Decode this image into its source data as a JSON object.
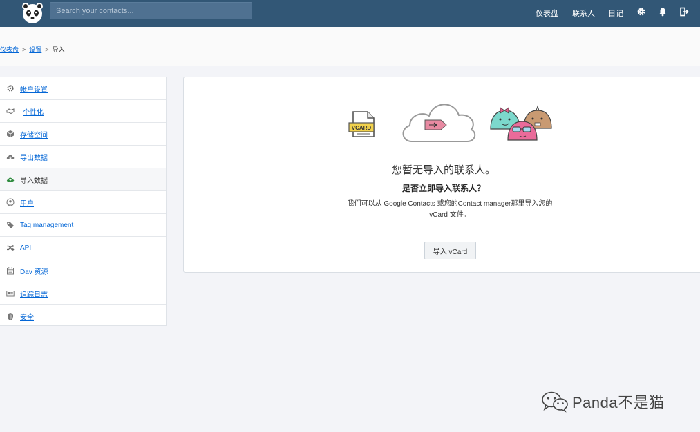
{
  "header": {
    "search_placeholder": "Search your contacts...",
    "nav": {
      "dashboard": "仪表盘",
      "contacts": "联系人",
      "journal": "日记"
    }
  },
  "breadcrumb": {
    "items": [
      "仪表盘",
      "设置",
      "导入"
    ],
    "separator": ">"
  },
  "sidebar": {
    "items": [
      {
        "label": "帐户设置",
        "icon": "gear-icon"
      },
      {
        "label": "个性化",
        "icon": "handshake-icon"
      },
      {
        "label": "存储空间",
        "icon": "cube-icon"
      },
      {
        "label": "导出数据",
        "icon": "cloud-download-icon"
      },
      {
        "label": "导入数据",
        "icon": "cloud-upload-icon",
        "active": true
      },
      {
        "label": "用户",
        "icon": "user-circle-icon"
      },
      {
        "label": "Tag management",
        "icon": "tags-icon"
      },
      {
        "label": "API",
        "icon": "random-icon"
      },
      {
        "label": "Dav 资源",
        "icon": "calendar-icon"
      },
      {
        "label": "追踪日志",
        "icon": "id-card-icon"
      },
      {
        "label": "安全",
        "icon": "shield-icon"
      }
    ]
  },
  "main": {
    "vcard_label": "VCARD",
    "empty_title": "您暂无导入的联系人。",
    "empty_question": "是否立即导入联系人？",
    "empty_description": "我们可以从 Google Contacts 或您的Contact manager那里导入您的 vCard 文件。",
    "import_button": "导入 vCard"
  },
  "watermark": {
    "text": "Panda不是猫"
  },
  "colors": {
    "topbar": "#325776",
    "link": "#0366d6",
    "background": "#f3f4f8",
    "active_upload_icon": "#2e8b3e"
  }
}
